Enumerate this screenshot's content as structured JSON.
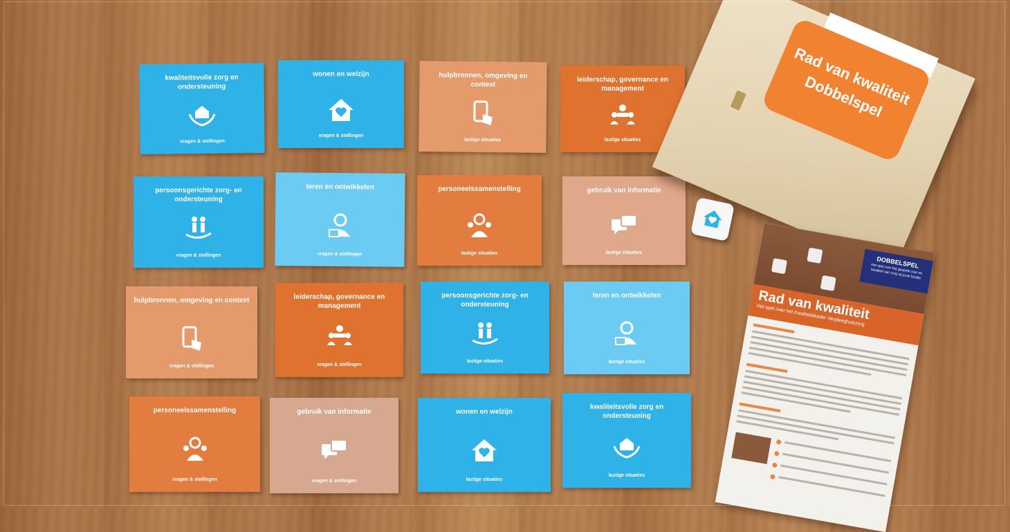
{
  "cards": [
    {
      "title": "kwaliteitsvolle zorg en ondersteuning",
      "icon": "hands-house-icon",
      "footer": "vragen & stellingen",
      "color": "#2fb2e8"
    },
    {
      "title": "wonen en welzijn",
      "icon": "house-heart-icon",
      "footer": "vragen & stellingen",
      "color": "#2fb2e8"
    },
    {
      "title": "hulpbronnen, omgeving en context",
      "icon": "tablet-hand-icon",
      "footer": "lastige situaties",
      "color": "#e59a6c"
    },
    {
      "title": "leiderschap, governance en management",
      "icon": "meeting-people-icon",
      "footer": "lastige situaties",
      "color": "#e0722f"
    },
    {
      "title": "persoonsgerichte zorg- en ondersteuning",
      "icon": "care-people-icon",
      "footer": "vragen & stellingen",
      "color": "#2fb2e8"
    },
    {
      "title": "leren en ontwikkelen",
      "icon": "person-laptop-icon",
      "footer": "vragen & stellingen",
      "color": "#6ccbf3"
    },
    {
      "title": "personeelssamenstelling",
      "icon": "team-people-icon",
      "footer": "lastige situaties",
      "color": "#e0722f"
    },
    {
      "title": "gebruik van informatie",
      "icon": "chat-bubbles-icon",
      "footer": "lastige situaties",
      "color": "#dfa88a"
    },
    {
      "title": "hulpbronnen, omgeving en context",
      "icon": "tablet-hand-icon",
      "footer": "vragen & stellingen",
      "color": "#e59a6c"
    },
    {
      "title": "leiderschap, governance en management",
      "icon": "meeting-people-icon",
      "footer": "vragen & stellingen",
      "color": "#e0722f"
    },
    {
      "title": "persoonsgerichte zorg- en ondersteuning",
      "icon": "care-people-icon",
      "footer": "lastige situaties",
      "color": "#2fb2e8"
    },
    {
      "title": "leren en ontwikkelen",
      "icon": "person-laptop-icon",
      "footer": "lastige situaties",
      "color": "#6ccbf3"
    },
    {
      "title": "personeelssamenstelling",
      "icon": "team-people-icon",
      "footer": "vragen & stellingen",
      "color": "#e0722f"
    },
    {
      "title": "gebruik van informatie",
      "icon": "chat-bubbles-icon",
      "footer": "vragen & stellingen",
      "color": "#d6a890"
    },
    {
      "title": "wonen en welzijn",
      "icon": "house-heart-icon",
      "footer": "lastige situaties",
      "color": "#2fb2e8"
    },
    {
      "title": "kwaliteitsvolle zorg en ondersteuning",
      "icon": "hands-house-icon",
      "footer": "lastige situaties",
      "color": "#2fb2e8"
    }
  ],
  "box": {
    "line1": "Rad van kwaliteit",
    "line2": "Dobbelspel"
  },
  "flyer": {
    "badge_title": "DOBBELSPEL",
    "badge_text": "Het spel over het gesprek over de kwaliteit van zorg op jouw locatie",
    "title": "Rad van kwaliteit",
    "subtitle": "Het spel over het Kwaliteitskader Verpleeghuiszorg"
  }
}
